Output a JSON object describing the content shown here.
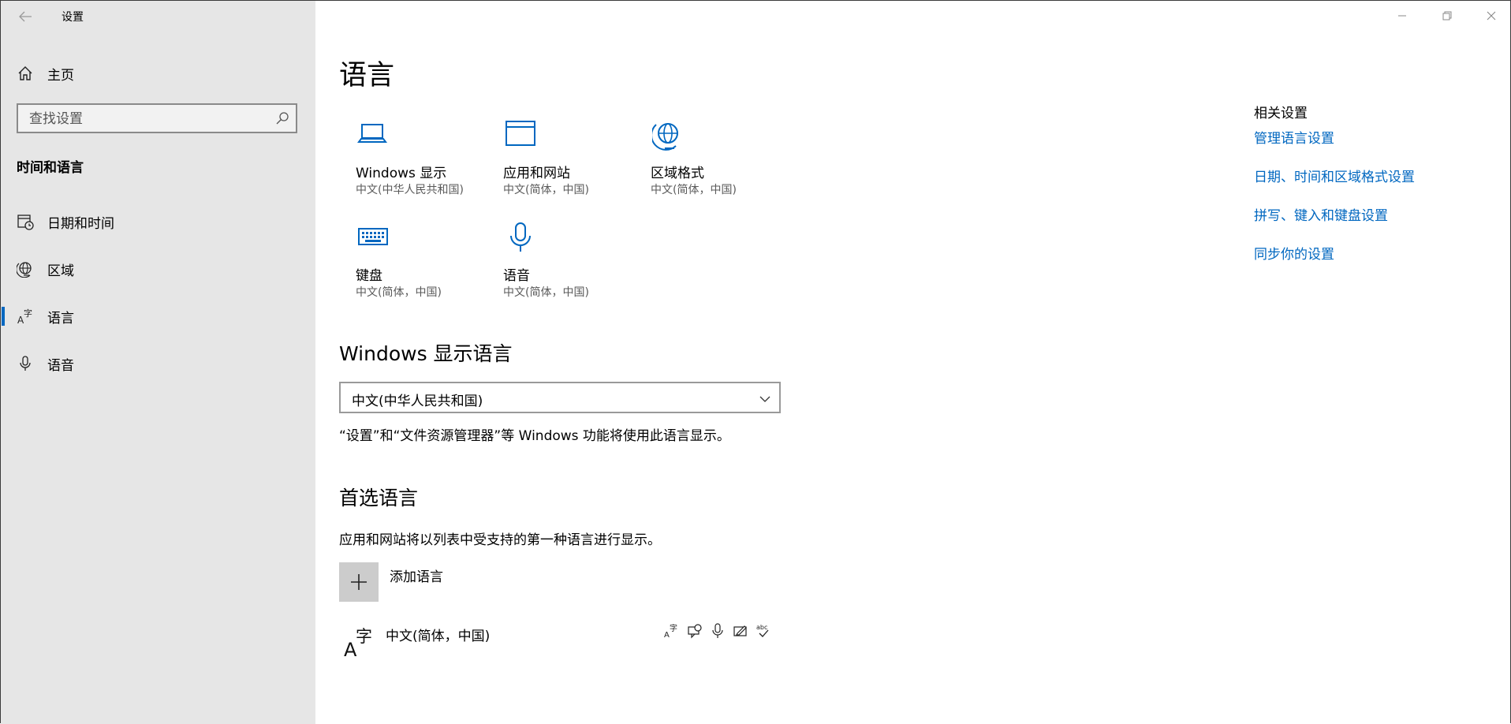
{
  "window": {
    "title": "设置"
  },
  "sidebar": {
    "home_label": "主页",
    "search_placeholder": "查找设置",
    "section_title": "时间和语言",
    "items": [
      {
        "label": "日期和时间",
        "icon": "calendar-clock-icon",
        "selected": false
      },
      {
        "label": "区域",
        "icon": "globe-icon",
        "selected": false
      },
      {
        "label": "语言",
        "icon": "language-icon",
        "selected": true
      },
      {
        "label": "语音",
        "icon": "microphone-icon",
        "selected": false
      }
    ]
  },
  "main": {
    "title": "语言",
    "tiles": [
      {
        "title": "Windows 显示",
        "subtitle": "中文(中华人民共和国)",
        "icon": "laptop-icon"
      },
      {
        "title": "应用和网站",
        "subtitle": "中文(简体，中国)",
        "icon": "browser-window-icon"
      },
      {
        "title": "区域格式",
        "subtitle": "中文(简体，中国)",
        "icon": "globe-format-icon"
      },
      {
        "title": "键盘",
        "subtitle": "中文(简体，中国)",
        "icon": "keyboard-icon"
      },
      {
        "title": "语音",
        "subtitle": "中文(简体，中国)",
        "icon": "microphone-icon"
      }
    ],
    "display_language": {
      "heading": "Windows 显示语言",
      "selected": "中文(中华人民共和国)",
      "description": "“设置”和“文件资源管理器”等 Windows 功能将使用此语言显示。"
    },
    "preferred": {
      "heading": "首选语言",
      "description": "应用和网站将以列表中受支持的第一种语言进行显示。",
      "add_label": "添加语言",
      "languages": [
        {
          "name": "中文(简体，中国)",
          "features": [
            "display-language-icon",
            "speech-recognition-icon",
            "text-to-speech-icon",
            "handwriting-icon",
            "spell-check-icon"
          ]
        }
      ]
    }
  },
  "related": {
    "heading": "相关设置",
    "links": [
      "管理语言设置",
      "日期、时间和区域格式设置",
      "拼写、键入和键盘设置",
      "同步你的设置"
    ]
  },
  "colors": {
    "accent": "#0067c0",
    "sidebar_bg": "#e6e6e6",
    "subtle_text": "#5a5a5a"
  }
}
